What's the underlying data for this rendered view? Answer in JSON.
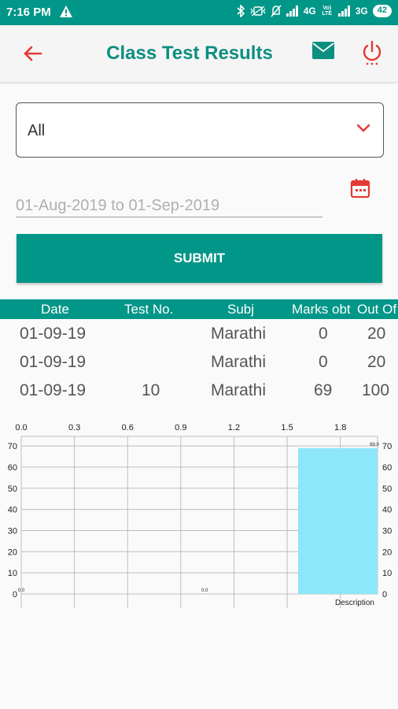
{
  "status_bar": {
    "time": "7:16 PM",
    "network_1": "4G",
    "network_2": "3G",
    "volte": "Vo) LTE",
    "battery": "42"
  },
  "app_bar": {
    "title": "Class Test Results"
  },
  "filter": {
    "selected": "All",
    "date_range_placeholder": "01-Aug-2019 to 01-Sep-2019",
    "submit_label": "SUBMIT"
  },
  "table": {
    "headers": [
      "Date",
      "Test No.",
      "Subj",
      "Marks obt",
      "Out Of"
    ],
    "rows": [
      [
        "01-09-19",
        "",
        "Marathi",
        "0",
        "20"
      ],
      [
        "01-09-19",
        "",
        "Marathi",
        "0",
        "20"
      ],
      [
        "01-09-19",
        "10",
        "Marathi",
        "69",
        "100"
      ]
    ]
  },
  "colors": {
    "primary": "#009688",
    "title": "#0d8f80",
    "accent_red": "#e53935",
    "bar": "#8ee6fb"
  },
  "icons": {
    "back": "arrow-left-icon",
    "mail": "mail-icon",
    "power": "power-icon",
    "dropdown": "chevron-down-icon",
    "calendar": "calendar-icon"
  },
  "chart_data": {
    "type": "bar",
    "x_ticks": [
      "0.0",
      "0.3",
      "0.6",
      "0.9",
      "1.2",
      "1.5",
      "1.8"
    ],
    "y_ticks": [
      "0",
      "10",
      "20",
      "30",
      "40",
      "50",
      "60",
      "70"
    ],
    "xlim": [
      0,
      2
    ],
    "ylim": [
      0,
      70
    ],
    "bars": [
      {
        "x": 0,
        "value": 0,
        "label": "0.0"
      },
      {
        "x": 1,
        "value": 0,
        "label": "0.0"
      },
      {
        "x": 2,
        "value": 69,
        "label": "69.0"
      }
    ],
    "description": "Description",
    "grid": true
  }
}
